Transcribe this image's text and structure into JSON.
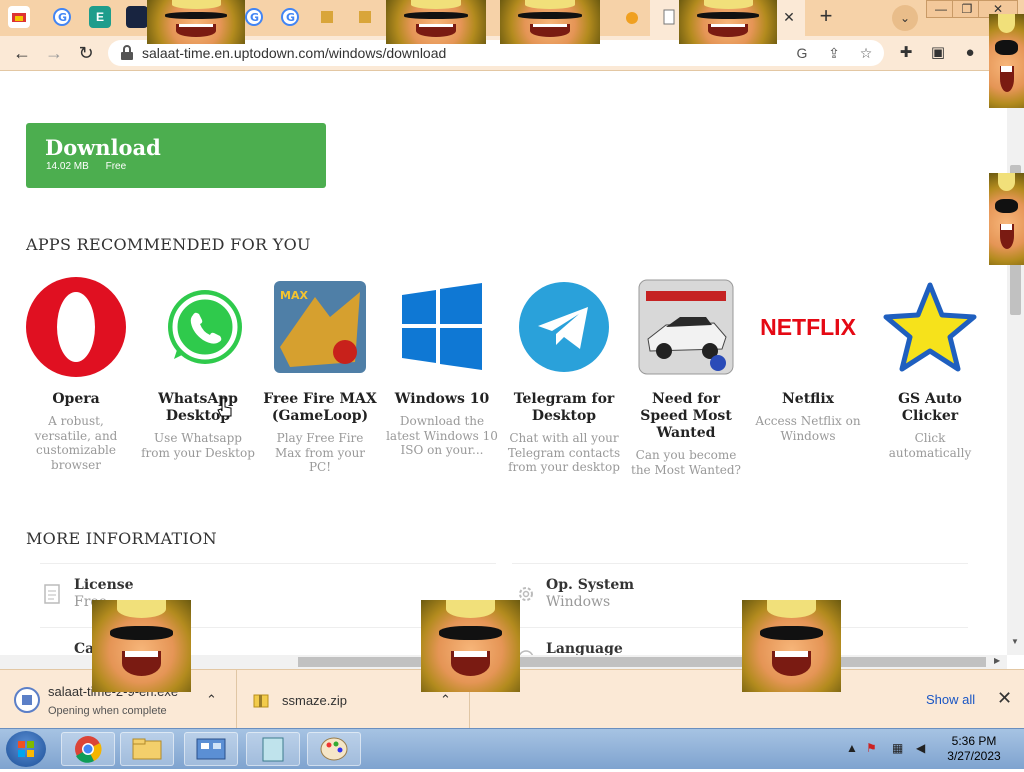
{
  "browser": {
    "address_url": "salaat-time.en.uptodown.com/windows/download",
    "tab_close_glyph": "✕",
    "new_tab_glyph": "+"
  },
  "download_button": {
    "label": "Download",
    "size": "14.02 MB",
    "license": "Free",
    "color": "#4cae4f"
  },
  "recommended": {
    "title": "APPS RECOMMENDED FOR YOU",
    "apps": [
      {
        "name": "Opera",
        "description": "A robust, versatile, and customizable browser",
        "icon": "opera-icon"
      },
      {
        "name": "WhatsApp Desktop",
        "description": "Use Whatsapp from your Desktop",
        "icon": "whatsapp-icon"
      },
      {
        "name": "Free Fire MAX (GameLoop)",
        "description": "Play Free Fire Max from your PC!",
        "icon": "free-fire-max-icon"
      },
      {
        "name": "Windows 10",
        "description": "Download the latest Windows 10 ISO on your...",
        "icon": "windows-icon"
      },
      {
        "name": "Telegram for Desktop",
        "description": "Chat with all your Telegram contacts from your desktop",
        "icon": "telegram-icon"
      },
      {
        "name": "Need for Speed Most Wanted",
        "description": "Can you become the Most Wanted?",
        "icon": "need-for-speed-icon"
      },
      {
        "name": "Netflix",
        "description": "Access Netflix on Windows",
        "icon": "netflix-icon",
        "logo_text": "NETFLIX"
      },
      {
        "name": "GS Auto Clicker",
        "description": "Click automatically",
        "icon": "gs-auto-clicker-icon"
      }
    ]
  },
  "more_info": {
    "title": "MORE INFORMATION",
    "items": [
      {
        "label": "License",
        "value": "Free",
        "icon": "license-icon"
      },
      {
        "label": "Op. System",
        "value": "Windows",
        "icon": "gear-icon"
      },
      {
        "label": "Ca",
        "value": "",
        "icon": "category-icon"
      },
      {
        "label": "Language",
        "value": "",
        "icon": "language-icon"
      }
    ]
  },
  "download_shelf": {
    "items": [
      {
        "name": "salaat-time-2-9-en.exe",
        "status": "Opening when complete"
      },
      {
        "name": "ssmaze.zip",
        "status": ""
      }
    ],
    "show_all": "Show all",
    "close_glyph": "✕"
  },
  "taskbar": {
    "time": "5:36 PM",
    "date": "3/27/2023"
  },
  "colors": {
    "tab_strip": "#f6d2a8",
    "toolbar": "#fbe9d6",
    "accent_green": "#4cae4f",
    "netflix_red": "#e50914",
    "telegram_blue": "#2aa1da",
    "whatsapp_green": "#2fca4c",
    "opera_red": "#e01021",
    "windows_blue": "#0f78d4"
  }
}
